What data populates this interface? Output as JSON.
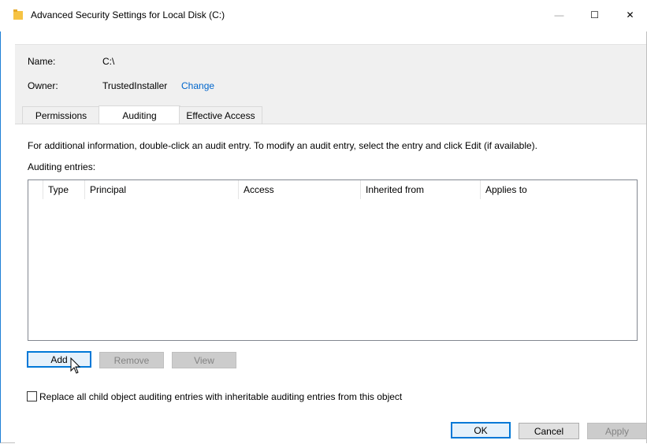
{
  "window": {
    "title": "Advanced Security Settings for Local Disk (C:)",
    "minimize_glyph": "—",
    "maximize_glyph": "☐",
    "close_glyph": "✕"
  },
  "info": {
    "name_label": "Name:",
    "name_value": "C:\\",
    "owner_label": "Owner:",
    "owner_value": "TrustedInstaller",
    "change_link": "Change"
  },
  "tabs": [
    {
      "label": "Permissions",
      "active": false
    },
    {
      "label": "Auditing",
      "active": true
    },
    {
      "label": "Effective Access",
      "active": false
    }
  ],
  "auditing": {
    "instruction": "For additional information, double-click an audit entry. To modify an audit entry, select the entry and click Edit (if available).",
    "entries_label": "Auditing entries:",
    "columns": [
      "Type",
      "Principal",
      "Access",
      "Inherited from",
      "Applies to"
    ],
    "rows": []
  },
  "buttons": {
    "add": "Add",
    "remove": "Remove",
    "view": "View",
    "ok": "OK",
    "cancel": "Cancel",
    "apply": "Apply"
  },
  "checkbox": {
    "label": "Replace all child object auditing entries with inheritable auditing entries from this object",
    "checked": false
  },
  "icons": {
    "title": "folder-icon",
    "cursor": "mouse-pointer-icon"
  },
  "colors": {
    "accent": "#0078d7",
    "link": "#0066cc",
    "folder": "#f6c344"
  }
}
